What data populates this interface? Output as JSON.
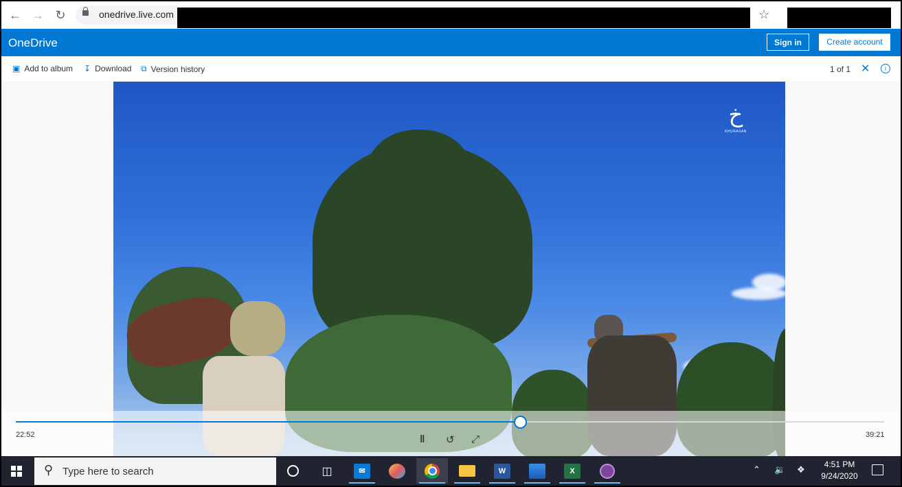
{
  "browser": {
    "url": "onedrive.live.com",
    "icons": {
      "back": "arrow-left-icon",
      "forward": "arrow-right-icon",
      "reload": "reload-icon",
      "lock": "lock-icon",
      "bookmark": "star-icon"
    }
  },
  "header": {
    "title": "OneDrive",
    "sign_in": "Sign in",
    "create_account": "Create account",
    "brand_color": "#0078d4"
  },
  "commands": {
    "add_to_album": "Add to album",
    "download": "Download",
    "version_history": "Version history",
    "pager": "1 of 1"
  },
  "player": {
    "current_time": "22:52",
    "duration": "39:21",
    "progress_fraction": 0.581,
    "watermark_text": "KHURASAN",
    "icons": [
      "pause-icon",
      "replay-icon",
      "fullscreen-icon"
    ]
  },
  "taskbar": {
    "search_placeholder": "Type here to search",
    "time": "4:51 PM",
    "date": "9/24/2020",
    "apps": [
      "cortana-icon",
      "task-view-icon",
      "mail-icon",
      "paint-icon",
      "chrome-icon",
      "file-explorer-icon",
      "word-icon",
      "photos-icon",
      "excel-icon",
      "tor-browser-icon"
    ],
    "tray": [
      "chevron-up-icon",
      "volume-icon",
      "dropbox-icon"
    ]
  }
}
